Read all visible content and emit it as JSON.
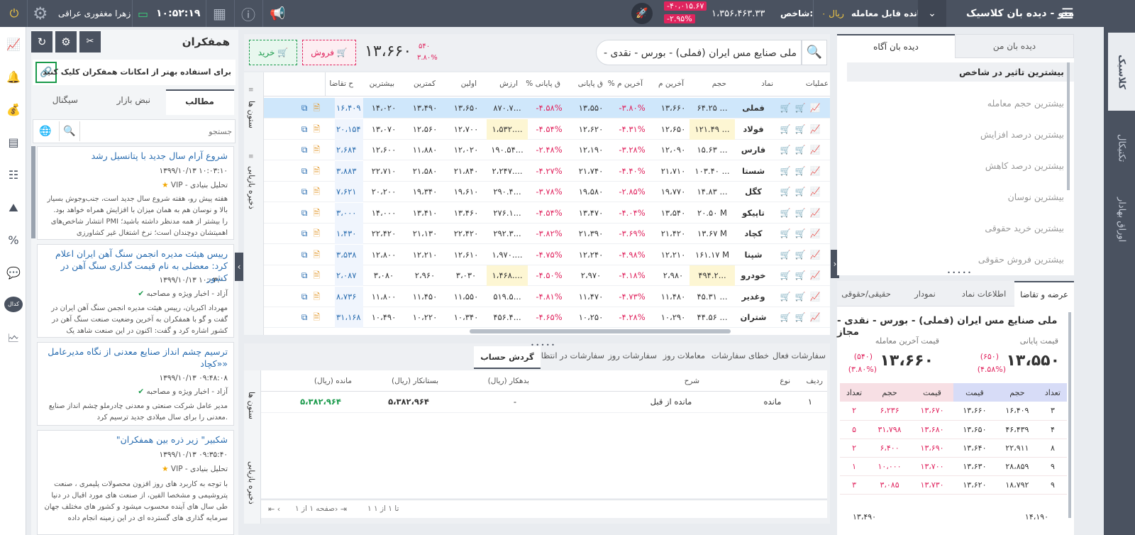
{
  "topbar": {
    "menu_label": "منو - دیده بان کلاسیک",
    "balance_label": "مانده قابل معامله:",
    "balance_value": "۰ ریال",
    "index_label": "شاخص:",
    "index_value": "۱،۳۵۶،۴۶۳.۳۳",
    "index_change": "-۴۰،۰۱۵.۶۷",
    "index_percent": "-۲.۹۵%",
    "clock": "۱۰:۵۲:۱۹",
    "user": "زهرا مغفوری عراقی"
  },
  "right_tabs": [
    "کلاسیک",
    "تکنیکال",
    "اوراق بهادار"
  ],
  "left_sidebar_icons": [
    "chart-line-icon",
    "notification-bell-icon",
    "coin-bag-icon",
    "document-icon",
    "list-icon",
    "chart-mountain-icon",
    "percent-icon",
    "help-chat-icon",
    "kedal-icon",
    "chart-window-icon"
  ],
  "left_sidebar_kedal": "کدال",
  "peers": {
    "title": "همفکران",
    "promo": "برای استفاده بهتر از امکانات همفکران کلیک کنید",
    "tabs": [
      "مطالب",
      "نبض بازار",
      "سیگنال"
    ],
    "search_placeholder": "جستجو",
    "news": [
      {
        "title": "شروع آرام سال جدید با پتانسیل رشد",
        "date": "۱۳۹۹/۱۰/۱۳ ۱۰:۰۳:۱۰",
        "category": "VIP - تحلیل بنیادی",
        "body": "هفته پیش رو، هفته شروع سال جدید است، جنب‌وجوش بسیار بالا و نوسان هم به همان میزان با افزایش همراه خواهد بود. انتشار شاخص‌های PMI را بیشتر از همه مدنظر داشته باشید؛ اهمیتشان دوچندان است؛ نرخ اشتغال غیر کشاورزی"
      },
      {
        "title": "رییس هیئت مدیره انجمن سنگ آهن ایران اعلام کرد: معضلی به نام قیمت گذاری سنگ آهن در کشور",
        "date": "۱۳۹۹/۱۰/۱۳ ۱۰:۰۳:۰۰",
        "category": "آزاد - اخبار ویژه و مصاحبه",
        "body": "مهرداد اکبریان، رییس هیئت مدیره انجمن سنگ آهن ایران در گفت و گو با همفکران به آخرین وضعیت صنعت سنگ آهن در کشور اشاره کرد و گفت: اکنون در این صنعت شاهد یک"
      },
      {
        "title": "ترسیم چشم انداز صنایع معدنی از نگاه مدیرعامل «کچاد»",
        "date": "۱۳۹۹/۱۰/۱۳ ۰۹:۴۸:۰۸",
        "category": "آزاد - اخبار ویژه و مصاحبه",
        "body": "مدیر عامل شرکت صنعتی و معدنی چادرملو چشم انداز صنایع معدنی را برای سال میلادی جدید ترسیم کرد."
      },
      {
        "title": "\"شکبیر\" زیر ذره بین همفکران",
        "date": "۱۳۹۹/۱۰/۱۳ ۰۹:۳۵:۴۰",
        "category": "VIP - تحلیل بنیادی",
        "body": "با توجه به کاربرد های روز افزون محصولات پلیمری ، صنعت پتروشیمی و مشخصا الفین، از صنعت های مورد اقبال در دنیا طی سال های آینده محسوب میشود و کشور های مختلف جهان سرمایه گذاری های گسترده ای در این زمینه انجام داده"
      }
    ]
  },
  "search": {
    "value": "ملی صنایع مس ایران (فملی) - بورس - نقدی - مجاز"
  },
  "trade": {
    "buy_label": "خرید",
    "sell_label": "فروش",
    "price": "۱۳،۶۶۰",
    "change": "۵۴۰",
    "percent": "۳.۸۰%"
  },
  "watch": {
    "columns": [
      "عملیات",
      "نماد",
      "حجم",
      "آخرین م",
      "% آخرین م",
      "ق پایانی",
      "% ق پایانی",
      "ارزش",
      "اولین",
      "کمترین",
      "بیشترین",
      "ح تقاضا"
    ],
    "side_labels": [
      "ستون ها",
      "ذخیره بازیابی"
    ],
    "rows": [
      {
        "symbol": "فملی",
        "volume": "۶۴.۲۵ ...",
        "last": "۱۳،۶۶۰",
        "last_pct": "-۳.۸۰%",
        "close": "۱۳،۵۵۰",
        "close_pct": "-۴.۵۸%",
        "value": "۸۷۰.۷...",
        "first": "۱۳،۶۵۰",
        "low": "۱۳،۴۹۰",
        "high": "۱۴،۰۲۰",
        "demand": "۱۶،۴۰۹"
      },
      {
        "symbol": "فولاد",
        "volume": "۱۲۱.۴۹ ...",
        "last": "۱۲،۶۵۰",
        "last_pct": "-۴.۳۱%",
        "close": "۱۲،۶۲۰",
        "close_pct": "-۴.۵۴%",
        "value": "۱،۵۳۲....",
        "first": "۱۲،۷۰۰",
        "low": "۱۲،۵۶۰",
        "high": "۱۳،۰۷۰",
        "demand": "۲۰،۱۵۴"
      },
      {
        "symbol": "فارس",
        "volume": "۱۵.۶۳ ...",
        "last": "۱۲،۰۹۰",
        "last_pct": "-۳.۲۸%",
        "close": "۱۲،۱۹۰",
        "close_pct": "-۲.۴۸%",
        "value": "۱۹۰.۵۴...",
        "first": "۱۲،۰۲۰",
        "low": "۱۱،۸۸۰",
        "high": "۱۲،۶۰۰",
        "demand": "۲،۶۸۴"
      },
      {
        "symbol": "شستا",
        "volume": "۱۰۳.۴۰ ...",
        "last": "۲۱،۷۱۰",
        "last_pct": "-۴.۴۰%",
        "close": "۲۱،۷۴۰",
        "close_pct": "-۴.۲۷%",
        "value": "۲،۲۴۷....",
        "first": "۲۱،۸۴۰",
        "low": "۲۱،۵۸۰",
        "high": "۲۲،۷۱۰",
        "demand": "۳،۸۸۳"
      },
      {
        "symbol": "کگل",
        "volume": "۱۴.۸۳ ...",
        "last": "۱۹،۷۷۰",
        "last_pct": "-۲.۸۵%",
        "close": "۱۹،۵۸۰",
        "close_pct": "-۳.۷۸%",
        "value": "۲۹۰.۴...",
        "first": "۱۹،۶۱۰",
        "low": "۱۹،۳۴۰",
        "high": "۲۰،۲۰۰",
        "demand": "۷،۶۲۱"
      },
      {
        "symbol": "تاپیکو",
        "volume": "۲۰.۵۰ M",
        "last": "۱۳،۵۴۰",
        "last_pct": "-۴.۰۴%",
        "close": "۱۳،۴۷۰",
        "close_pct": "-۴.۵۴%",
        "value": "۲۷۶.۱...",
        "first": "۱۳،۴۶۰",
        "low": "۱۳،۴۱۰",
        "high": "۱۴،۰۰۰",
        "demand": "۳،۰۰۰"
      },
      {
        "symbol": "کچاد",
        "volume": "۱۳.۶۷ M",
        "last": "۲۱،۴۲۰",
        "last_pct": "-۳.۶۹%",
        "close": "۲۱،۳۹۰",
        "close_pct": "-۳.۸۲%",
        "value": "۲۹۲.۳...",
        "first": "۲۲،۴۲۰",
        "low": "۲۱،۱۳۰",
        "high": "۲۲،۴۲۰",
        "demand": "۱،۴۳۰"
      },
      {
        "symbol": "شپنا",
        "volume": "۱۶۱.۱۷ M",
        "last": "۱۲،۲۱۰",
        "last_pct": "-۴.۹۸%",
        "close": "۱۲،۲۴۰",
        "close_pct": "-۴.۷۵%",
        "value": "۱،۹۷۰....",
        "first": "۱۲،۶۱۰",
        "low": "۱۲،۲۱۰",
        "high": "۱۲،۸۰۰",
        "demand": "۳،۵۳۸"
      },
      {
        "symbol": "خودرو",
        "volume": "۴۹۴.۲...",
        "last": "۲،۹۸۰",
        "last_pct": "-۴.۱۸%",
        "close": "۲،۹۷۰",
        "close_pct": "-۴.۵۰%",
        "value": "۱،۴۶۸....",
        "first": "۳،۰۳۰",
        "low": "۲،۹۶۰",
        "high": "۳،۰۸۰",
        "demand": "۲،۰۸۷"
      },
      {
        "symbol": "وغدیر",
        "volume": "۴۵.۳۱ ...",
        "last": "۱۱،۴۸۰",
        "last_pct": "-۴.۷۳%",
        "close": "۱۱،۴۷۰",
        "close_pct": "-۴.۸۱%",
        "value": "۵۱۹.۵...",
        "first": "۱۱،۵۵۰",
        "low": "۱۱،۴۵۰",
        "high": "۱۱،۸۰۰",
        "demand": "۸،۷۳۶"
      },
      {
        "symbol": "شتران",
        "volume": "۴۴.۵۶ ...",
        "last": "۱۰،۲۹۰",
        "last_pct": "-۴.۲۸%",
        "close": "۱۰،۲۵۰",
        "close_pct": "-۴.۶۵%",
        "value": "۴۵۶.۴...",
        "first": "۱۰،۳۴۰",
        "low": "۱۰،۲۲۰",
        "high": "۱۰،۴۹۰",
        "demand": "۳۱،۱۶۸"
      }
    ]
  },
  "orders": {
    "tabs": [
      "سفارشات فعال",
      "خطای سفارشات",
      "معاملات روز",
      "سفارشات روز",
      "سفارشات در انتظار",
      "گردش حساب روز"
    ],
    "columns": [
      "ردیف",
      "نوع",
      "شرح",
      "بدهکار (ریال)",
      "بستانکار (ریال)",
      "مانده (ریال)"
    ],
    "row": {
      "index": "۱",
      "type": "مانده",
      "desc": "مانده از قبل",
      "debit": "-",
      "credit": "۵،۳۸۲،۹۶۴",
      "balance": "۵،۳۸۲،۹۶۴"
    },
    "pager": {
      "range": "۱ تا ۱ از ۱",
      "page": "صفحه ۱ از ۱"
    }
  },
  "watchlists": {
    "tabs": [
      "دیده بان من",
      "دیده بان آگاه"
    ],
    "items": [
      "بیشترین تاثیر در شاخص",
      "بیشترین حجم معامله",
      "بیشترین درصد افزایش",
      "بیشترین درصد کاهش",
      "بیشترین نوسان",
      "بیشترین خرید حقوقی",
      "بیشترین فروش حقوقی"
    ]
  },
  "orderbook": {
    "tabs": [
      "عرضه و تقاضا",
      "اطلاعات نماد",
      "نمودار",
      "حقیقی/حقوقی"
    ],
    "title": "ملی صنایع مس ایران (فملی) - بورس - نقدی - مجاز",
    "close_label": "قیمت پایانی",
    "close_value": "۱۳،۵۵۰",
    "close_change": "(۶۵۰)",
    "close_pct": "(۴.۵۸%)",
    "last_label": "قیمت آخرین معامله",
    "last_value": "۱۳،۶۶۰",
    "last_change": "(۵۴۰)",
    "last_pct": "(۳.۸۰%)",
    "columns": [
      "تعداد",
      "حجم",
      "قیمت",
      "قیمت",
      "حجم",
      "تعداد"
    ],
    "rows": [
      [
        "۳",
        "۱۶،۴۰۹",
        "۱۳،۶۶۰",
        "۱۳،۶۷۰",
        "۶،۲۳۶",
        "۲"
      ],
      [
        "۴",
        "۴۶،۴۳۹",
        "۱۳،۶۵۰",
        "۱۳،۶۸۰",
        "۳۱،۷۹۸",
        "۵"
      ],
      [
        "۸",
        "۲۲،۹۱۱",
        "۱۳،۶۴۰",
        "۱۳،۶۹۰",
        "۶،۴۰۰",
        "۲"
      ],
      [
        "۹",
        "۲۸،۸۵۹",
        "۱۳،۶۳۰",
        "۱۳،۷۰۰",
        "۱۰،۰۰۰",
        "۱"
      ],
      [
        "۹",
        "۱۸،۷۹۲",
        "۱۳،۶۲۰",
        "۱۳،۷۳۰",
        "۳،۰۸۵",
        "۳"
      ]
    ],
    "footer": [
      "۱۴،۱۹۰",
      "۱۳،۴۹۰"
    ]
  },
  "colors": {
    "topbar": "#4a5260",
    "accent": "#2a6db0",
    "negative": "#e0245e",
    "positive": "#1a9a4b",
    "highlight": "#cfe7fb"
  }
}
